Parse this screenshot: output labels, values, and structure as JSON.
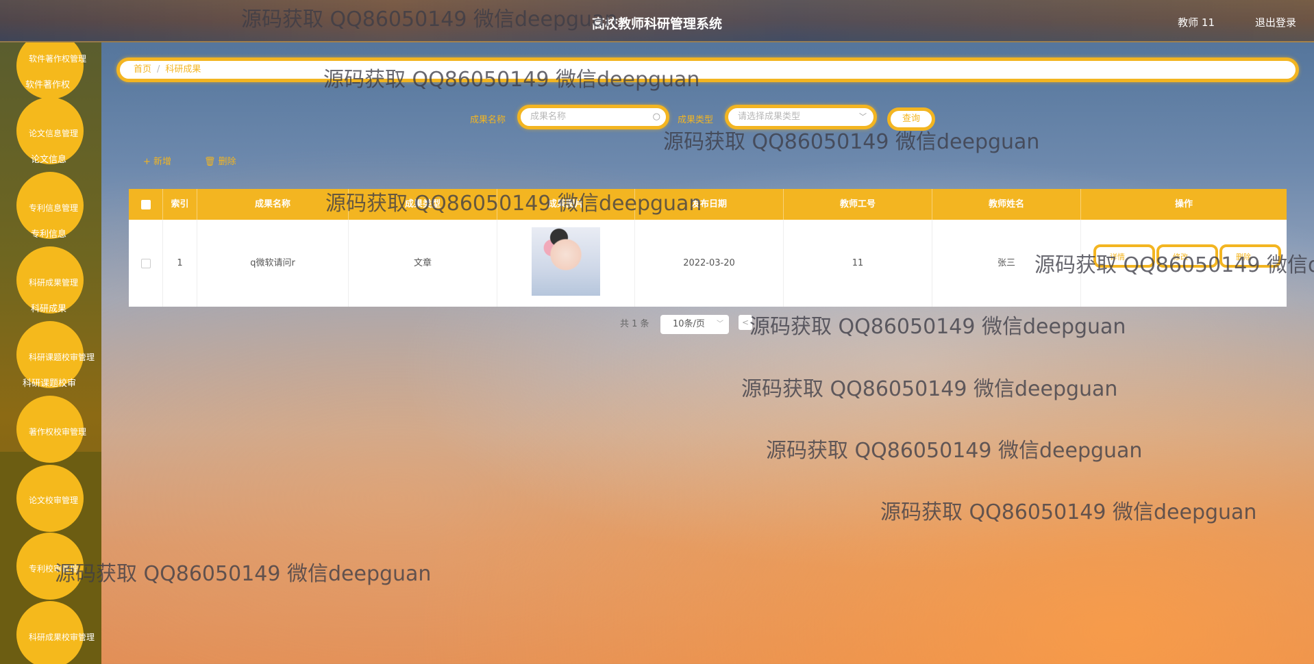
{
  "header": {
    "title": "高校教师科研管理系统",
    "user": "教师 11",
    "logout": "退出登录"
  },
  "sidebar": {
    "items": [
      {
        "label": "软件著作权管理",
        "sub": "软件著作权"
      },
      {
        "label": "论文信息管理",
        "sub": "论文信息"
      },
      {
        "label": "专利信息管理",
        "sub": "专利信息"
      },
      {
        "label": "科研成果管理",
        "sub": "科研成果"
      },
      {
        "label": "科研课题校审管理",
        "sub": "科研课题校审"
      },
      {
        "label": "著作权校审管理",
        "sub": ""
      },
      {
        "label": "论文校审管理",
        "sub": ""
      },
      {
        "label": "专利校审管理",
        "sub": ""
      },
      {
        "label": "科研成果校审管理",
        "sub": ""
      }
    ]
  },
  "breadcrumb": {
    "home": "首页",
    "sep": "/",
    "current": "科研成果"
  },
  "search": {
    "name_label": "成果名称",
    "name_placeholder": "成果名称",
    "type_label": "成果类型",
    "type_placeholder": "请选择成果类型",
    "button": "查询"
  },
  "toolbar": {
    "add": "+ 新增",
    "delete": "删除"
  },
  "table": {
    "headers": [
      "索引",
      "成果名称",
      "成果类型",
      "成果图片",
      "发布日期",
      "教师工号",
      "教师姓名",
      "操作"
    ],
    "rows": [
      {
        "index": "1",
        "name": "q微软请问r",
        "type": "文章",
        "date": "2022-03-20",
        "teacher_id": "11",
        "teacher_name": "张三",
        "ops": [
          "详情",
          "修改",
          "删除"
        ]
      }
    ]
  },
  "pagination": {
    "total": "共 1 条",
    "page_size": "10条/页",
    "prev": "<"
  },
  "watermark": "源码获取 QQ86050149 微信deepguan"
}
